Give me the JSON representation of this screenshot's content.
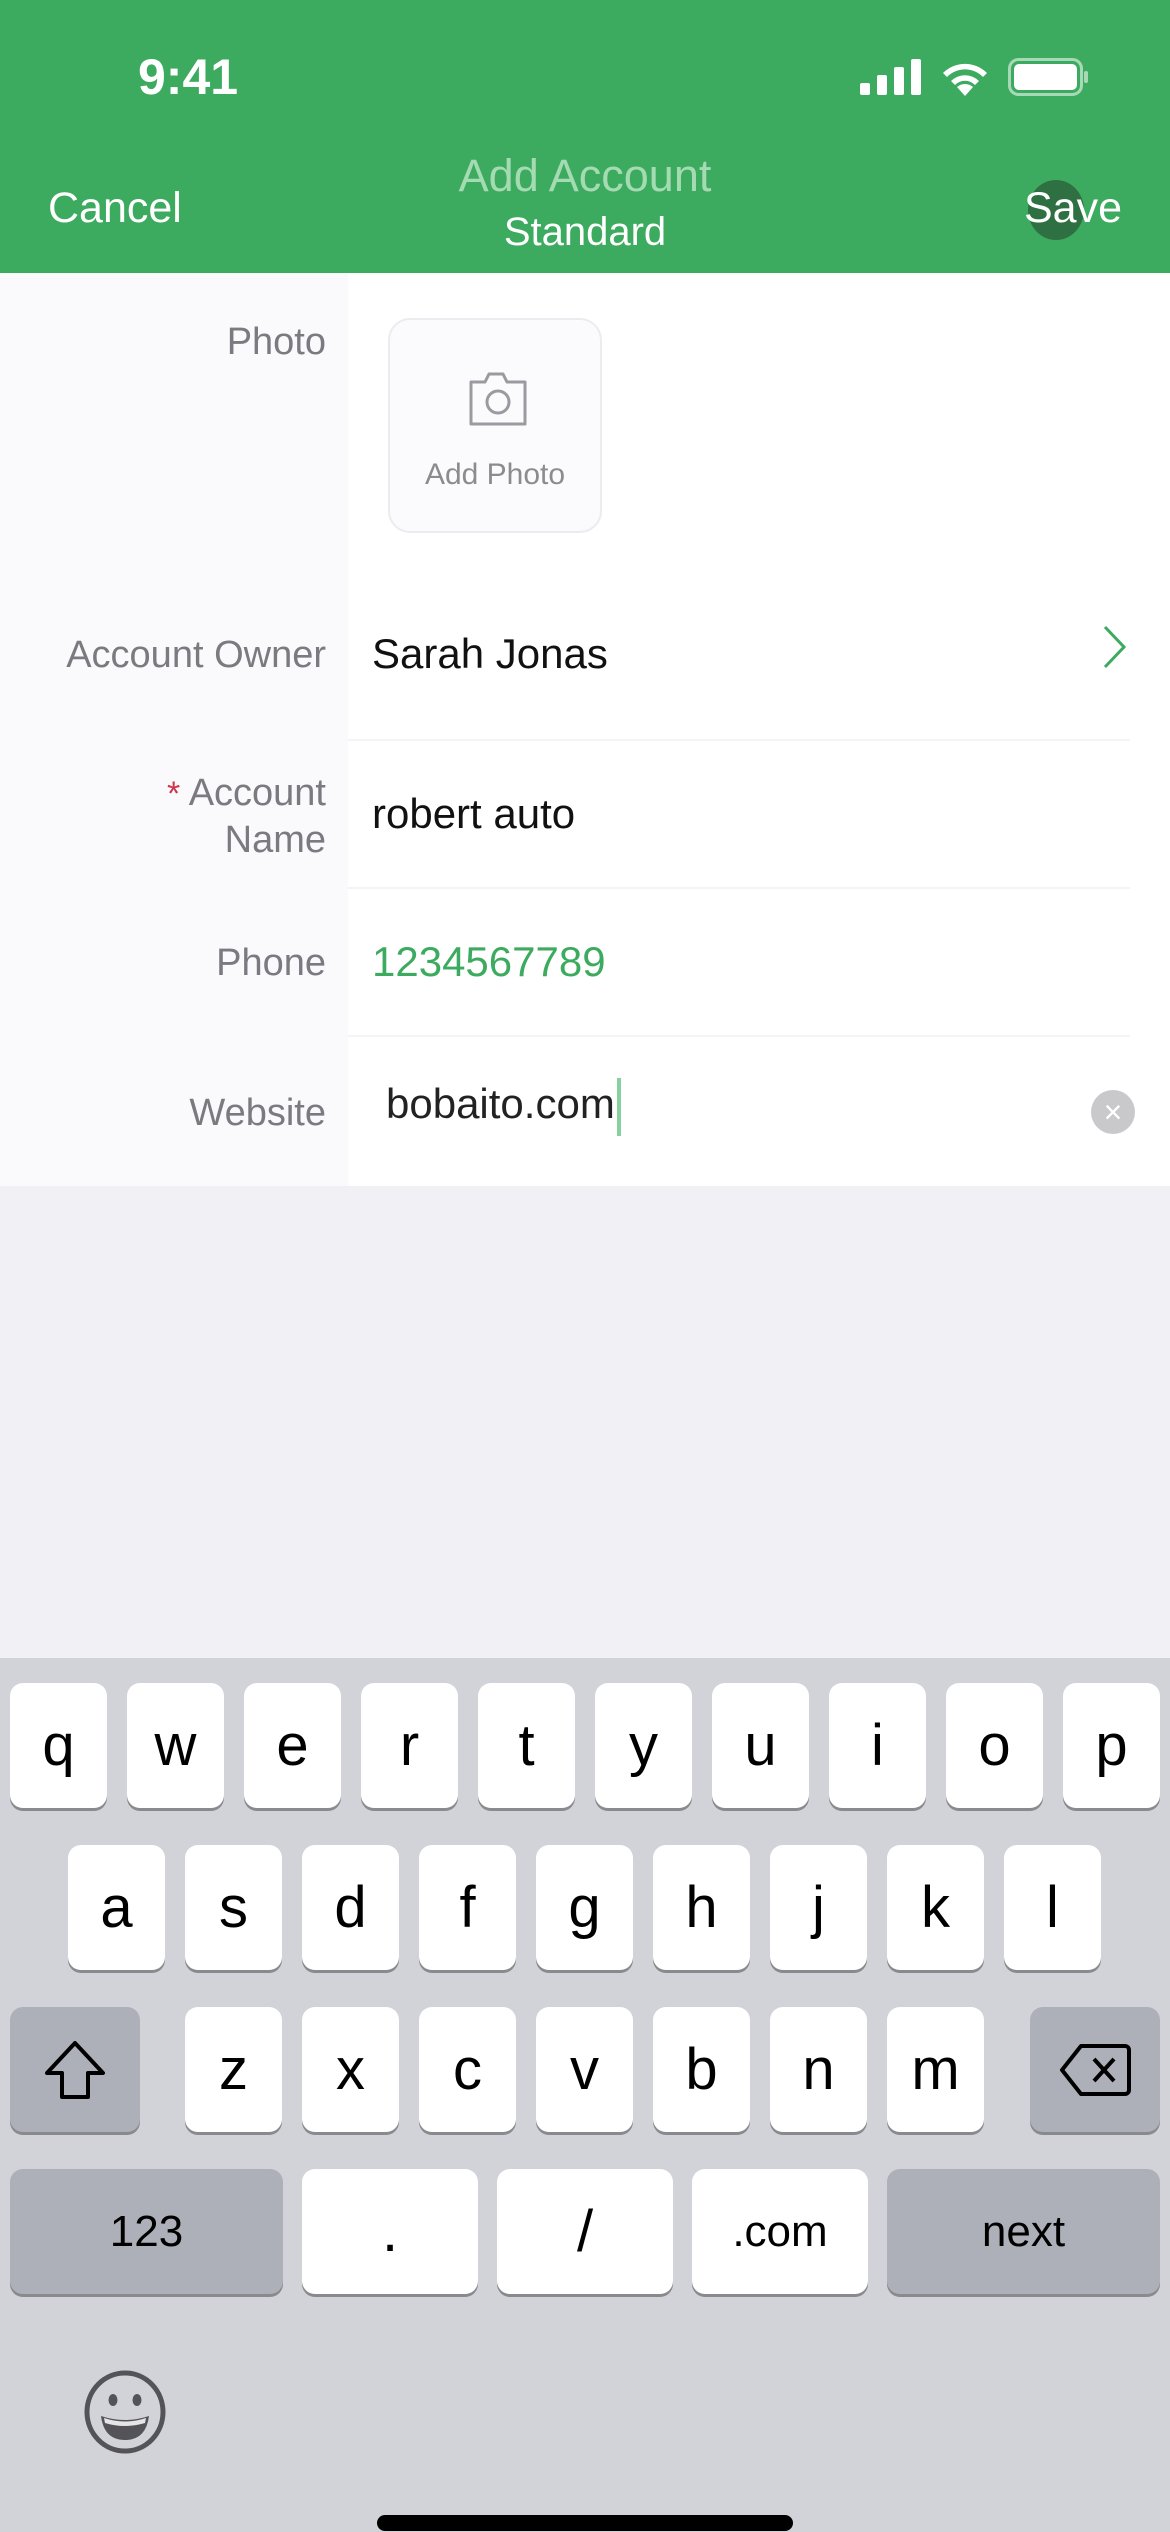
{
  "status_bar": {
    "time": "9:41",
    "icons": [
      "cellular-signal-icon",
      "wifi-icon",
      "battery-icon"
    ]
  },
  "nav": {
    "cancel_label": "Cancel",
    "title": "Add Account",
    "subtitle": "Standard",
    "save_label": "Save"
  },
  "colors": {
    "brand": "#3dab5f",
    "required": "#d0364a",
    "label": "#7b7a80"
  },
  "form": {
    "photo": {
      "label": "Photo",
      "button_label": "Add Photo",
      "icon": "camera-icon"
    },
    "account_owner": {
      "label": "Account Owner",
      "value": "Sarah Jonas",
      "icon": "chevron-right-icon"
    },
    "account_name": {
      "required_mark": "*",
      "label_line1": "Account",
      "label_line2": "Name",
      "value": "robert auto"
    },
    "phone": {
      "label": "Phone",
      "value": "1234567789"
    },
    "website": {
      "label": "Website",
      "value": "bobaito.com",
      "clear_icon": "clear-icon"
    }
  },
  "keyboard": {
    "row1": [
      "q",
      "w",
      "e",
      "r",
      "t",
      "y",
      "u",
      "i",
      "o",
      "p"
    ],
    "row2": [
      "a",
      "s",
      "d",
      "f",
      "g",
      "h",
      "j",
      "k",
      "l"
    ],
    "row3": [
      "z",
      "x",
      "c",
      "v",
      "b",
      "n",
      "m"
    ],
    "row4": {
      "numbers": "123",
      "dot": ".",
      "slash": "/",
      "dotcom": ".com",
      "next": "next"
    }
  }
}
